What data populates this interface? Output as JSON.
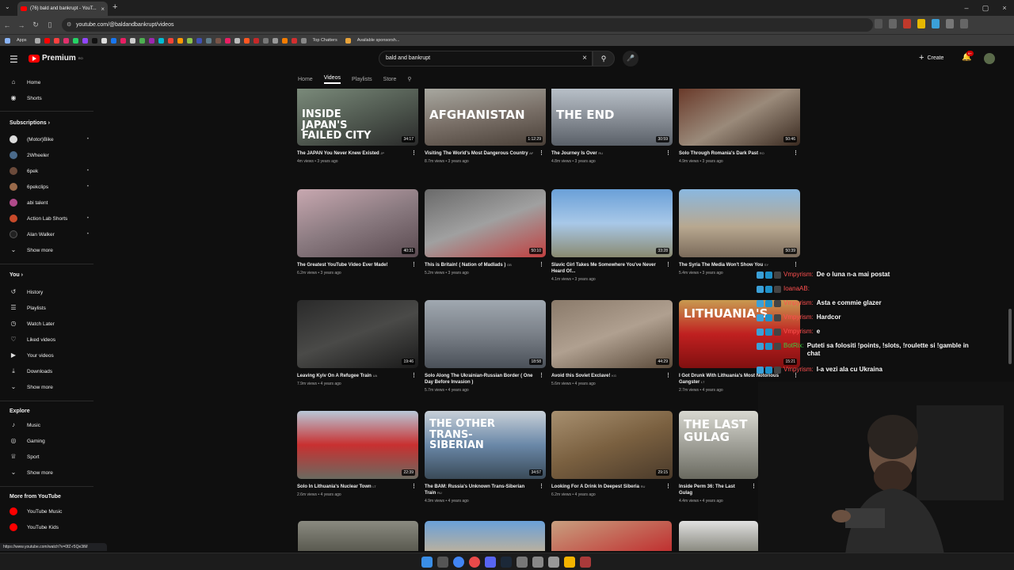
{
  "browser": {
    "tab_title": "(76) bald and bankrupt - YouT...",
    "url": "youtube.com/@baldandbankrupt/videos",
    "bookmarks": [
      {
        "label": "Apps",
        "color": "#8ab4f8"
      },
      {
        "label": "Top Chatters",
        "color": "#888888"
      },
      {
        "label": "Available sponsorsh...",
        "color": "#e8a33a"
      }
    ]
  },
  "header": {
    "logo_text": "Premium",
    "logo_region": "RO",
    "search_value": "bald and bankrupt",
    "create_label": "Create",
    "notifications_badge": "9+"
  },
  "sidebar": {
    "main": [
      {
        "label": "Home",
        "icon": "home-icon",
        "glyph": "⌂"
      },
      {
        "label": "Shorts",
        "icon": "shorts-icon",
        "glyph": "◉"
      }
    ],
    "subscriptions_title": "Subscriptions",
    "subscriptions": [
      {
        "label": "(Motor)Bike",
        "color": "#dddddd"
      },
      {
        "label": "2Wheeler",
        "color": "#4a6a8a"
      },
      {
        "label": "6pek",
        "color": "#6b4a3a"
      },
      {
        "label": "6pekclips",
        "color": "#9a6a4a"
      },
      {
        "label": "abi talent",
        "color": "#b04a8a"
      },
      {
        "label": "Action Lab Shorts",
        "color": "#c84a2a"
      },
      {
        "label": "Alan Walker",
        "color": "#222222"
      }
    ],
    "show_more": "Show more",
    "you_title": "You",
    "you_items": [
      {
        "label": "History",
        "icon": "history-icon",
        "glyph": "↺"
      },
      {
        "label": "Playlists",
        "icon": "playlists-icon",
        "glyph": "☰"
      },
      {
        "label": "Watch Later",
        "icon": "clock-icon",
        "glyph": "◷"
      },
      {
        "label": "Liked videos",
        "icon": "thumbs-up-icon",
        "glyph": "👍"
      },
      {
        "label": "Your videos",
        "icon": "your-videos-icon",
        "glyph": "▶"
      },
      {
        "label": "Downloads",
        "icon": "download-icon",
        "glyph": "⤓"
      }
    ],
    "explore_title": "Explore",
    "explore_items": [
      {
        "label": "Music",
        "icon": "music-icon",
        "glyph": "♪"
      },
      {
        "label": "Gaming",
        "icon": "gaming-icon",
        "glyph": "🎮"
      },
      {
        "label": "Sport",
        "icon": "trophy-icon",
        "glyph": "🏆"
      }
    ],
    "more_title": "More from YouTube",
    "more_items": [
      {
        "label": "YouTube Music",
        "color": "#ff0000"
      },
      {
        "label": "YouTube Kids",
        "color": "#ff0000"
      }
    ]
  },
  "channel_tabs": [
    "Home",
    "Videos",
    "Playlists",
    "Store"
  ],
  "active_tab": "Videos",
  "videos": [
    {
      "title": "The JAPAN You Never Knew Existed",
      "flag": "JP",
      "views": "4m views",
      "age": "3 years ago",
      "duration": "34:17",
      "thumb_text": "INSIDE JAPAN'S FAILED CITY",
      "bg": "linear-gradient(160deg,#7a8a7a,#4a524a 60%,#2a2a2a)"
    },
    {
      "title": "Visiting The World's Most Dangerous Country",
      "flag": "AF",
      "views": "8.7m views",
      "age": "3 years ago",
      "duration": "1:12:29",
      "thumb_text": "AFGHANISTAN",
      "bg": "linear-gradient(170deg,#a8a8a0,#7a7068 50%,#4a4038)"
    },
    {
      "title": "The Journey Is Over",
      "flag": "RU",
      "views": "4.8m views",
      "age": "3 years ago",
      "duration": "30:59",
      "thumb_text": "THE END",
      "bg": "linear-gradient(180deg,#b8c0c8,#8a9098 50%,#5a6068)"
    },
    {
      "title": "Solo Through Romania's Dark Past",
      "flag": "RO",
      "views": "4.9m views",
      "age": "3 years ago",
      "duration": "50:46",
      "thumb_text": "",
      "bg": "linear-gradient(150deg,#6a3a2a,#9a8a7a 50%,#3a2a20)"
    },
    {
      "title": "The Greatest YouTube Video Ever Made!",
      "flag": "",
      "views": "6.2m views",
      "age": "3 years ago",
      "duration": "40:31",
      "thumb_text": "",
      "bg": "linear-gradient(160deg,#c8a8b0,#8a7a80 50%,#5a4a50)"
    },
    {
      "title": "This is Britain! ( Nation of Madlads )",
      "flag": "GB",
      "views": "5.2m views",
      "age": "3 years ago",
      "duration": "50:10",
      "thumb_text": "",
      "bg": "linear-gradient(160deg,#6a6a6a,#a0a0a0 50%,#c04040)"
    },
    {
      "title": "Slavic Girl Takes Me Somewhere You've Never Heard Of...",
      "flag": "",
      "views": "4.1m views",
      "age": "3 years ago",
      "duration": "33:28",
      "thumb_text": "",
      "bg": "linear-gradient(180deg,#6aa0d8,#a8c8e8 50%,#8a8a70)"
    },
    {
      "title": "The Syria The Media Won't Show You",
      "flag": "SY",
      "views": "5.4m views",
      "age": "3 years ago",
      "duration": "50:39",
      "thumb_text": "",
      "bg": "linear-gradient(180deg,#8ab8e0,#b8a890 55%,#7a6a5a)"
    },
    {
      "title": "Leaving Kyiv On A Refugee Train",
      "flag": "UA",
      "views": "7.9m views",
      "age": "4 years ago",
      "duration": "19:46",
      "thumb_text": "",
      "bg": "linear-gradient(160deg,#2a2a2a,#4a4a48 50%,#1a1a1a)"
    },
    {
      "title": "Solo Along The Ukrainian-Russian Border ( One Day Before Invasion )",
      "flag": "",
      "views": "5.7m views",
      "age": "4 years ago",
      "duration": "18:58",
      "thumb_text": "",
      "bg": "linear-gradient(180deg,#a0a8b0,#7a8088 50%,#4a5058)"
    },
    {
      "title": "Avoid this Soviet Exclave!",
      "flag": "KG",
      "views": "5.6m views",
      "age": "4 years ago",
      "duration": "44:29",
      "thumb_text": "",
      "bg": "linear-gradient(160deg,#8a7a6a,#b0a090 50%,#5a4a3a)"
    },
    {
      "title": "I Got Drunk With Lithuania's Most Notorious Gangster",
      "flag": "LT",
      "views": "2.7m views",
      "age": "4 years ago",
      "duration": "15:21",
      "thumb_text": "LITHUANIA'S",
      "bg": "linear-gradient(180deg,#c89a50,#c02020 50%,#801010)"
    },
    {
      "title": "Solo In Lithuania's Nuclear Town",
      "flag": "LT",
      "views": "2.6m views",
      "age": "4 years ago",
      "duration": "22:39",
      "thumb_text": "",
      "bg": "linear-gradient(180deg,#b8c8d8,#c83030 50%,#6a6a60)"
    },
    {
      "title": "The BAM: Russia's Unknown Trans-Siberian Train",
      "flag": "RU",
      "views": "4.9m views",
      "age": "4 years ago",
      "duration": "34:57",
      "thumb_text": "THE OTHER TRANS-SIBERIAN",
      "bg": "linear-gradient(180deg,#c8d0d8,#6a88a8 50%,#3a4a58)"
    },
    {
      "title": "Looking For A Drink In Deepest Siberia",
      "flag": "RU",
      "views": "6.2m views",
      "age": "4 years ago",
      "duration": "29:15",
      "thumb_text": "",
      "bg": "linear-gradient(160deg,#a89070,#7a6040 50%,#4a3a2a)"
    },
    {
      "title": "Inside Perm 36: The Last Gulag",
      "flag": "",
      "views": "4.4m views",
      "age": "4 years ago",
      "duration": "",
      "thumb_text": "THE LAST GULAG",
      "bg": "linear-gradient(180deg,#d8d8d0,#a0a098 50%,#6a6a60)"
    }
  ],
  "chat": [
    {
      "user": "Vmpyrism:",
      "message": "De o luna n-a mai postat",
      "user_color": "#ff4f4f"
    },
    {
      "user": "IoanaAB:",
      "message": "",
      "user_color": "#ff4f4f"
    },
    {
      "user": "Vmpyrism:",
      "message": "Asta e commie glazer",
      "user_color": "#ff4f4f"
    },
    {
      "user": "Vmpyrism:",
      "message": "Hardcor",
      "user_color": "#ff4f4f"
    },
    {
      "user": "Vmpyrism:",
      "message": "e",
      "user_color": "#ff4f4f"
    },
    {
      "user": "BotRix:",
      "message": "Puteti sa folositi !points, !slots, !roulette si !gamble in chat",
      "user_color": "#3fc93f"
    },
    {
      "user": "Vmpyrism:",
      "message": "I-a vezi ala cu Ukraina",
      "user_color": "#ff4f4f"
    }
  ],
  "status_url": "https://www.youtube.com/watch?v=0fZ-r5Qe3tM"
}
